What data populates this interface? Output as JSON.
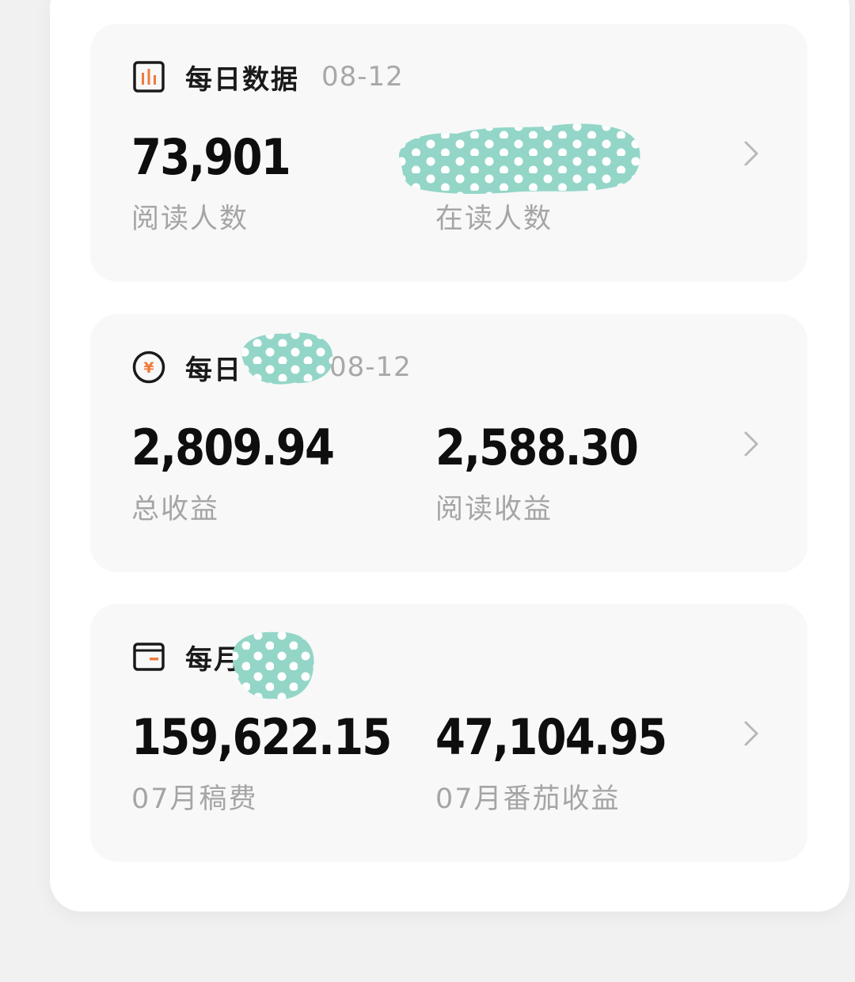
{
  "colors": {
    "accent_orange": "#f07a3a",
    "blob_teal": "#93d6c8",
    "value_black": "#0e0e0e",
    "label_gray": "#a5a5a5"
  },
  "cards": [
    {
      "icon": "bar-chart-icon",
      "title": "每日数据",
      "date": "08-12",
      "stats": [
        {
          "value": "73,901",
          "label": "阅读人数"
        },
        {
          "value": "",
          "label": "在读人数"
        }
      ]
    },
    {
      "icon": "yuan-coin-icon",
      "title": "每日",
      "date": "08-12",
      "stats": [
        {
          "value": "2,809.94",
          "label": "总收益"
        },
        {
          "value": "2,588.30",
          "label": "阅读收益"
        }
      ]
    },
    {
      "icon": "wallet-icon",
      "title": "每月",
      "date": "",
      "stats": [
        {
          "value": "159,622.15",
          "label": "07月稿费"
        },
        {
          "value": "47,104.95",
          "label": "07月番茄收益"
        }
      ]
    }
  ]
}
